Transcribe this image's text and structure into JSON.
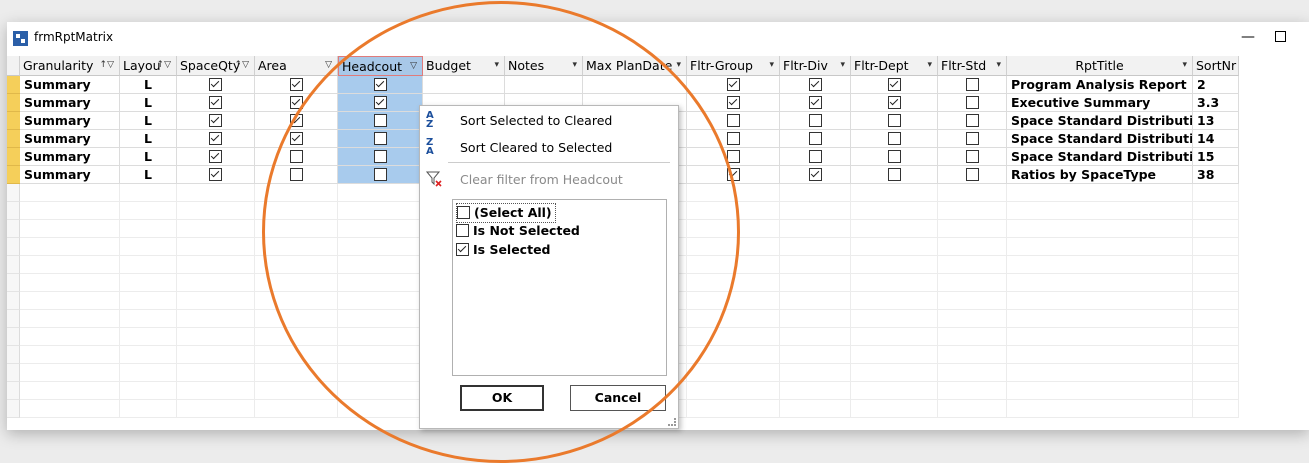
{
  "window": {
    "title": "frmRptMatrix",
    "min_glyph": "—"
  },
  "columns": [
    {
      "key": "granularity",
      "label": "Granularity",
      "filter": "filter-sort"
    },
    {
      "key": "layout",
      "label": "Layou",
      "filter": "filter-sort"
    },
    {
      "key": "spaceqty",
      "label": "SpaceQty",
      "filter": "filter-sort"
    },
    {
      "key": "area",
      "label": "Area",
      "filter": "filter"
    },
    {
      "key": "headcout",
      "label": "Headcout",
      "filter": "filter"
    },
    {
      "key": "budget",
      "label": "Budget",
      "filter": "dropdown"
    },
    {
      "key": "notes",
      "label": "Notes",
      "filter": "dropdown"
    },
    {
      "key": "maxplandate",
      "label": "Max PlanDate",
      "filter": "dropdown"
    },
    {
      "key": "fltrgroup",
      "label": "Fltr-Group",
      "filter": "dropdown"
    },
    {
      "key": "fltrdiv",
      "label": "Fltr-Div",
      "filter": "dropdown"
    },
    {
      "key": "fltrdept",
      "label": "Fltr-Dept",
      "filter": "dropdown"
    },
    {
      "key": "fltrstd",
      "label": "Fltr-Std",
      "filter": "dropdown"
    },
    {
      "key": "rpttitle",
      "label": "RptTitle",
      "filter": "dropdown"
    },
    {
      "key": "sortnr",
      "label": "SortNr",
      "filter": "none"
    }
  ],
  "header_glyphs": {
    "filter_sort": "↑▽",
    "filter": "▽",
    "dropdown": "▾"
  },
  "rows": [
    {
      "granularity": "Summary",
      "layout": "L",
      "spaceqty": true,
      "area": true,
      "headcout": true,
      "fltrgroup": true,
      "fltrdiv": true,
      "fltrdept": true,
      "fltrstd": false,
      "rpttitle": "Program Analysis Report",
      "sortnr": "2"
    },
    {
      "granularity": "Summary",
      "layout": "L",
      "spaceqty": true,
      "area": true,
      "headcout": true,
      "fltrgroup": true,
      "fltrdiv": true,
      "fltrdept": true,
      "fltrstd": false,
      "rpttitle": "Executive Summary",
      "sortnr": "3.3"
    },
    {
      "granularity": "Summary",
      "layout": "L",
      "spaceqty": true,
      "area": true,
      "headcout": false,
      "fltrgroup": false,
      "fltrdiv": false,
      "fltrdept": false,
      "fltrstd": false,
      "rpttitle": "Space Standard Distribution by",
      "sortnr": "13"
    },
    {
      "granularity": "Summary",
      "layout": "L",
      "spaceqty": true,
      "area": true,
      "headcout": false,
      "fltrgroup": false,
      "fltrdiv": false,
      "fltrdept": false,
      "fltrstd": false,
      "rpttitle": "Space Standard Distribution by",
      "sortnr": "14"
    },
    {
      "granularity": "Summary",
      "layout": "L",
      "spaceqty": true,
      "area": false,
      "headcout": false,
      "fltrgroup": false,
      "fltrdiv": false,
      "fltrdept": false,
      "fltrstd": false,
      "rpttitle": "Space Standard Distribution by",
      "sortnr": "15"
    },
    {
      "granularity": "Summary",
      "layout": "L",
      "spaceqty": true,
      "area": false,
      "headcout": false,
      "fltrgroup": true,
      "fltrdiv": true,
      "fltrdept": false,
      "fltrstd": false,
      "rpttitle": "Ratios by SpaceType",
      "sortnr": "38"
    }
  ],
  "filter_popup": {
    "sort_az_label": "Sort Selected to Cleared",
    "sort_za_label": "Sort Cleared to Selected",
    "clear_filter_label": "Clear filter from Headcout",
    "sort_az_glyph": "A Z",
    "sort_za_glyph": "Z A",
    "items": [
      {
        "label": "(Select All)",
        "checked": false
      },
      {
        "label": "Is Not Selected",
        "checked": false
      },
      {
        "label": "Is Selected",
        "checked": true
      }
    ],
    "ok_label": "OK",
    "cancel_label": "Cancel"
  },
  "colors": {
    "highlight_circle": "#ea7a2c",
    "selected_column": "#a8cbed",
    "row_selector": "#f5cf5a"
  }
}
